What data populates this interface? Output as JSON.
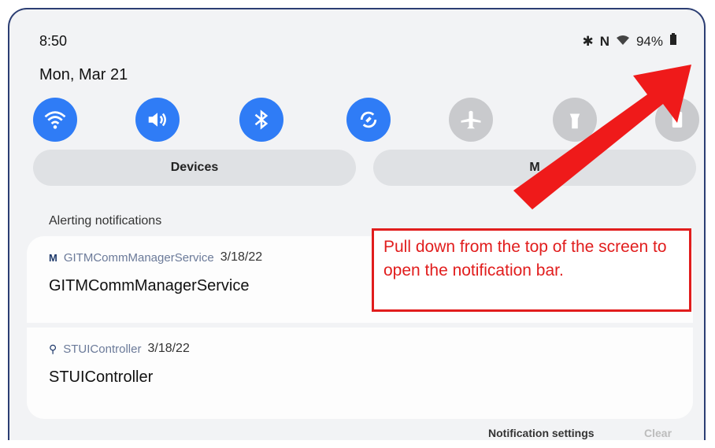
{
  "status_bar": {
    "time": "8:50",
    "right_text": "94%",
    "icons": [
      "bluetooth-icon",
      "nfc-icon",
      "wifi-icon",
      "battery-icon"
    ]
  },
  "header": {
    "date": "Mon, Mar 21",
    "settings_icon": "gear-icon"
  },
  "quick_settings": [
    {
      "name": "wifi",
      "state": "on"
    },
    {
      "name": "sound",
      "state": "on"
    },
    {
      "name": "bluetooth",
      "state": "on"
    },
    {
      "name": "auto-rotate",
      "state": "on"
    },
    {
      "name": "airplane",
      "state": "off"
    },
    {
      "name": "flashlight",
      "state": "off"
    },
    {
      "name": "power-saving",
      "state": "off"
    }
  ],
  "pills": {
    "devices": "Devices",
    "media": "M"
  },
  "notifications": {
    "section_title": "Alerting notifications",
    "items": [
      {
        "app": "GITMCommManagerService",
        "date": "3/18/22",
        "title": "GITMCommManagerService"
      },
      {
        "app": "STUIController",
        "date": "3/18/22",
        "title": "STUIController"
      }
    ]
  },
  "footer": {
    "settings": "Notification settings",
    "clear": "Clear"
  },
  "annotation": {
    "text": "Pull down from the top of the screen to open the notification bar.",
    "color": "#e11d1d"
  },
  "colors": {
    "accent": "#2f7cf6",
    "inactive": "#c9cacd"
  }
}
